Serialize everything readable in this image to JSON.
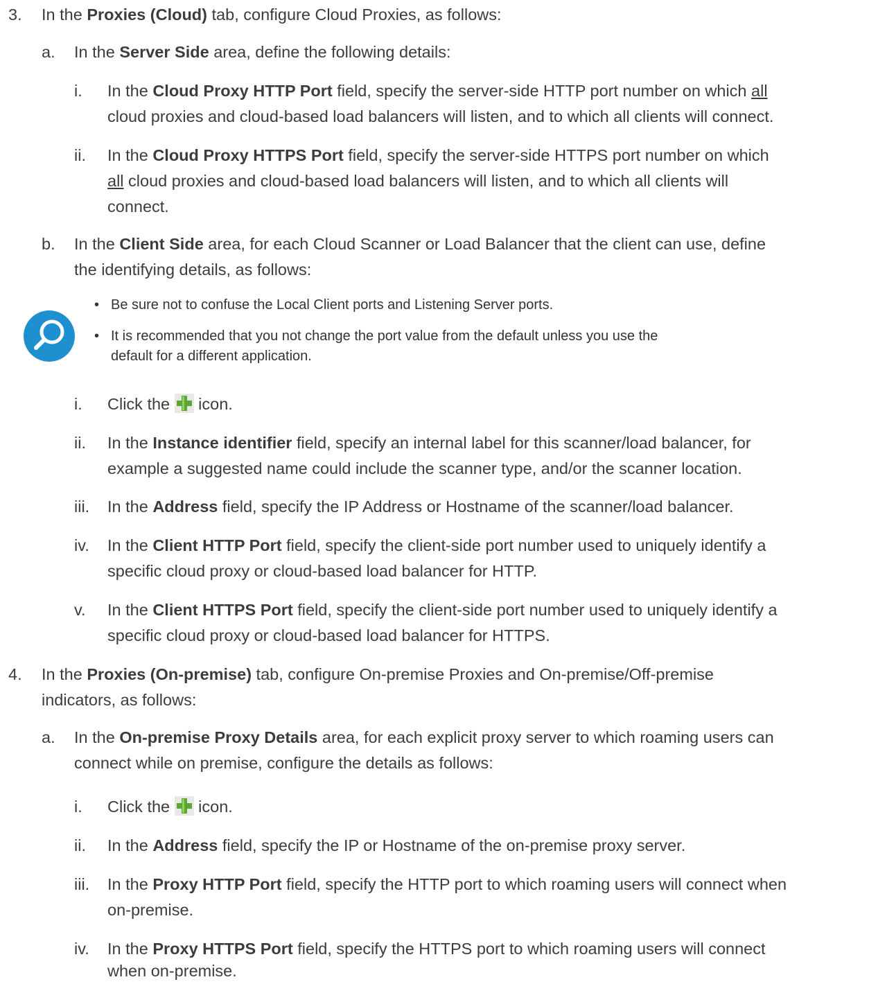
{
  "step3": {
    "num": "3.",
    "pre": "In the ",
    "bold": "Proxies (Cloud)",
    "post": " tab, configure Cloud Proxies, as follows:"
  },
  "step3a": {
    "num": "a.",
    "pre": "In the ",
    "bold": "Server Side",
    "post": " area, define the following details:"
  },
  "step3a_i": {
    "num": "i.",
    "pre": "In the ",
    "bold": "Cloud Proxy HTTP Port",
    "line1_post": " field, specify the server-side HTTP port number on which ",
    "underline": "all",
    "line2": "cloud proxies and cloud-based load balancers will listen, and to which all clients will connect."
  },
  "step3a_ii": {
    "num": "ii.",
    "pre": "In the ",
    "bold": "Cloud Proxy HTTPS Port",
    "line1_post": " field, specify the server-side HTTPS port number on which",
    "underline": "all",
    "line2_post": " cloud proxies and cloud-based load balancers will listen, and to which all clients will",
    "line3": "connect."
  },
  "step3b": {
    "num": "b.",
    "pre": "In the ",
    "bold": "Client Side",
    "line1_post": " area, for each Cloud Scanner or Load Balancer that the client can use, define",
    "line2": "the identifying details, as follows:"
  },
  "note": {
    "icon": "magnifier-icon",
    "bullet1": "Be sure not to confuse the Local Client ports and Listening Server ports.",
    "bullet2_line1": "It is recommended that you not change the port value from the default unless you use the",
    "bullet2_line2": "default for a different application."
  },
  "step3b_i": {
    "num": "i.",
    "pre": "Click the ",
    "icon": "plus-icon",
    "post": " icon."
  },
  "step3b_ii": {
    "num": "ii.",
    "pre": "In the ",
    "bold": "Instance identifier",
    "line1_post": " field, specify an internal label for this scanner/load balancer, for",
    "line2": "example a suggested name could include the scanner type, and/or the scanner location."
  },
  "step3b_iii": {
    "num": "iii.",
    "pre": "In the ",
    "bold": "Address",
    "post": " field, specify the IP Address or Hostname of the scanner/load balancer."
  },
  "step3b_iv": {
    "num": "iv.",
    "pre": "In the ",
    "bold": "Client HTTP Port",
    "line1_post": " field, specify the client-side port number used to uniquely identify a",
    "line2": "specific cloud proxy or cloud-based load balancer for HTTP."
  },
  "step3b_v": {
    "num": "v.",
    "pre": "In the ",
    "bold": "Client HTTPS Port",
    "line1_post": " field, specify the client-side port number used to uniquely identify a",
    "line2": "specific cloud proxy or cloud-based load balancer for HTTPS."
  },
  "step4": {
    "num": "4.",
    "pre": "In the ",
    "bold": "Proxies (On-premise)",
    "line1_post": " tab, configure On-premise Proxies and On-premise/Off-premise",
    "line2": "indicators, as follows:"
  },
  "step4a": {
    "num": "a.",
    "pre": "In the ",
    "bold": "On-premise Proxy Details",
    "line1_post": " area, for each explicit proxy server to which roaming users can",
    "line2": "connect while on premise, configure the details as follows:"
  },
  "step4a_i": {
    "num": "i.",
    "pre": "Click the ",
    "icon": "plus-icon",
    "post": " icon."
  },
  "step4a_ii": {
    "num": "ii.",
    "pre": "In the ",
    "bold": "Address",
    "post": " field, specify the IP or Hostname of the on-premise proxy server."
  },
  "step4a_iii": {
    "num": "iii.",
    "pre": "In the ",
    "bold": "Proxy HTTP Port",
    "line1_post": " field, specify the HTTP port to which roaming users will connect when",
    "line2": "on-premise."
  },
  "step4a_iv": {
    "num": "iv.",
    "pre": "In the ",
    "bold": "Proxy HTTPS Port",
    "line1_post": " field, specify the HTTPS port to which roaming users will connect",
    "line2": "when on-premise."
  },
  "colors": {
    "text": "#3c3c3c",
    "note_icon": "#1e8fcf",
    "plus_icon": "#5aa832"
  }
}
